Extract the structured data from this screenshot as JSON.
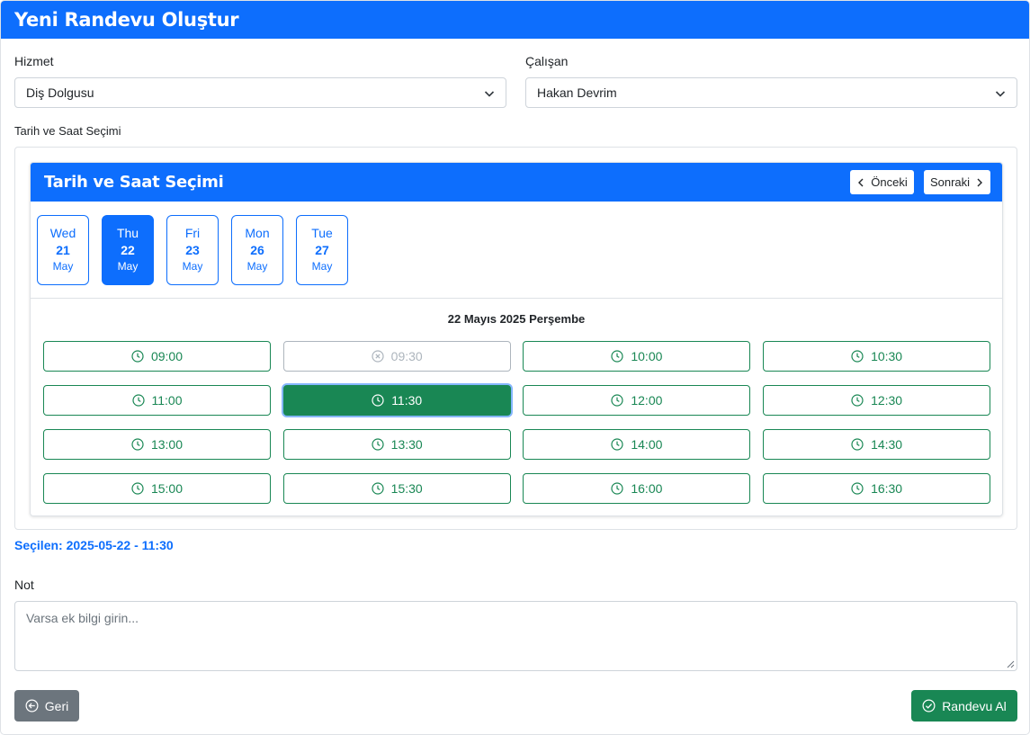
{
  "header": {
    "title": "Yeni Randevu Oluştur"
  },
  "form": {
    "service_label": "Hizmet",
    "service_value": "Diş Dolgusu",
    "employee_label": "Çalışan",
    "employee_value": "Hakan Devrim",
    "datetime_label": "Tarih ve Saat Seçimi",
    "note_label": "Not",
    "note_placeholder": "Varsa ek bilgi girin..."
  },
  "picker": {
    "title": "Tarih ve Saat Seçimi",
    "prev_label": "Önceki",
    "next_label": "Sonraki",
    "days": [
      {
        "name": "Wed",
        "date": "21",
        "month": "May",
        "active": false
      },
      {
        "name": "Thu",
        "date": "22",
        "month": "May",
        "active": true
      },
      {
        "name": "Fri",
        "date": "23",
        "month": "May",
        "active": false
      },
      {
        "name": "Mon",
        "date": "26",
        "month": "May",
        "active": false
      },
      {
        "name": "Tue",
        "date": "27",
        "month": "May",
        "active": false
      }
    ],
    "selected_date_title": "22 Mayıs 2025 Perşembe",
    "slots": [
      {
        "time": "09:00",
        "state": "available"
      },
      {
        "time": "09:30",
        "state": "disabled"
      },
      {
        "time": "10:00",
        "state": "available"
      },
      {
        "time": "10:30",
        "state": "available"
      },
      {
        "time": "11:00",
        "state": "available"
      },
      {
        "time": "11:30",
        "state": "selected"
      },
      {
        "time": "12:00",
        "state": "available"
      },
      {
        "time": "12:30",
        "state": "available"
      },
      {
        "time": "13:00",
        "state": "available"
      },
      {
        "time": "13:30",
        "state": "available"
      },
      {
        "time": "14:00",
        "state": "available"
      },
      {
        "time": "14:30",
        "state": "available"
      },
      {
        "time": "15:00",
        "state": "available"
      },
      {
        "time": "15:30",
        "state": "available"
      },
      {
        "time": "16:00",
        "state": "available"
      },
      {
        "time": "16:30",
        "state": "available"
      }
    ]
  },
  "selection": {
    "text": "Seçilen: 2025-05-22 - 11:30"
  },
  "actions": {
    "back_label": "Geri",
    "submit_label": "Randevu Al"
  },
  "colors": {
    "primary": "#0d6efd",
    "success": "#198754",
    "secondary": "#6c757d",
    "muted": "#adb5bd"
  },
  "icons": {
    "slot": "clock-icon",
    "slot_disabled": "x-circle-icon",
    "back": "arrow-left-circle-icon",
    "submit": "check-circle-icon",
    "prev": "chevron-left-icon",
    "next": "chevron-right-icon",
    "select": "chevron-down-icon"
  }
}
